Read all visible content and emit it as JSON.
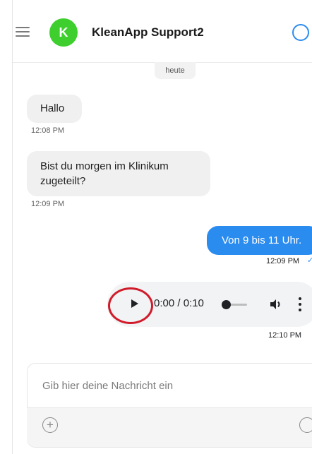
{
  "header": {
    "contact_name": "KleanApp Support2",
    "avatar_letter": "K",
    "avatar_color": "#3ecf2e"
  },
  "date_separator": "heute",
  "messages": [
    {
      "direction": "in",
      "text": "Hallo",
      "time": "12:08 PM"
    },
    {
      "direction": "in",
      "text": "Bist du morgen im Klinikum zugeteilt?",
      "time": "12:09 PM"
    },
    {
      "direction": "out",
      "text": "Von 9 bis 11 Uhr.",
      "time": "12:09 PM"
    },
    {
      "direction": "out",
      "type": "audio",
      "time": "12:10 PM",
      "player_time": "0:00 / 0:10",
      "progress": 0
    }
  ],
  "composer": {
    "placeholder": "Gib hier deine Nachricht ein"
  },
  "colors": {
    "accent": "#2b8cf0",
    "highlight": "#d01b2a"
  },
  "icons": [
    "menu-icon",
    "info-icon",
    "play-icon",
    "volume-icon",
    "more-icon",
    "add-icon",
    "emoji-icon",
    "read-check-icon"
  ]
}
